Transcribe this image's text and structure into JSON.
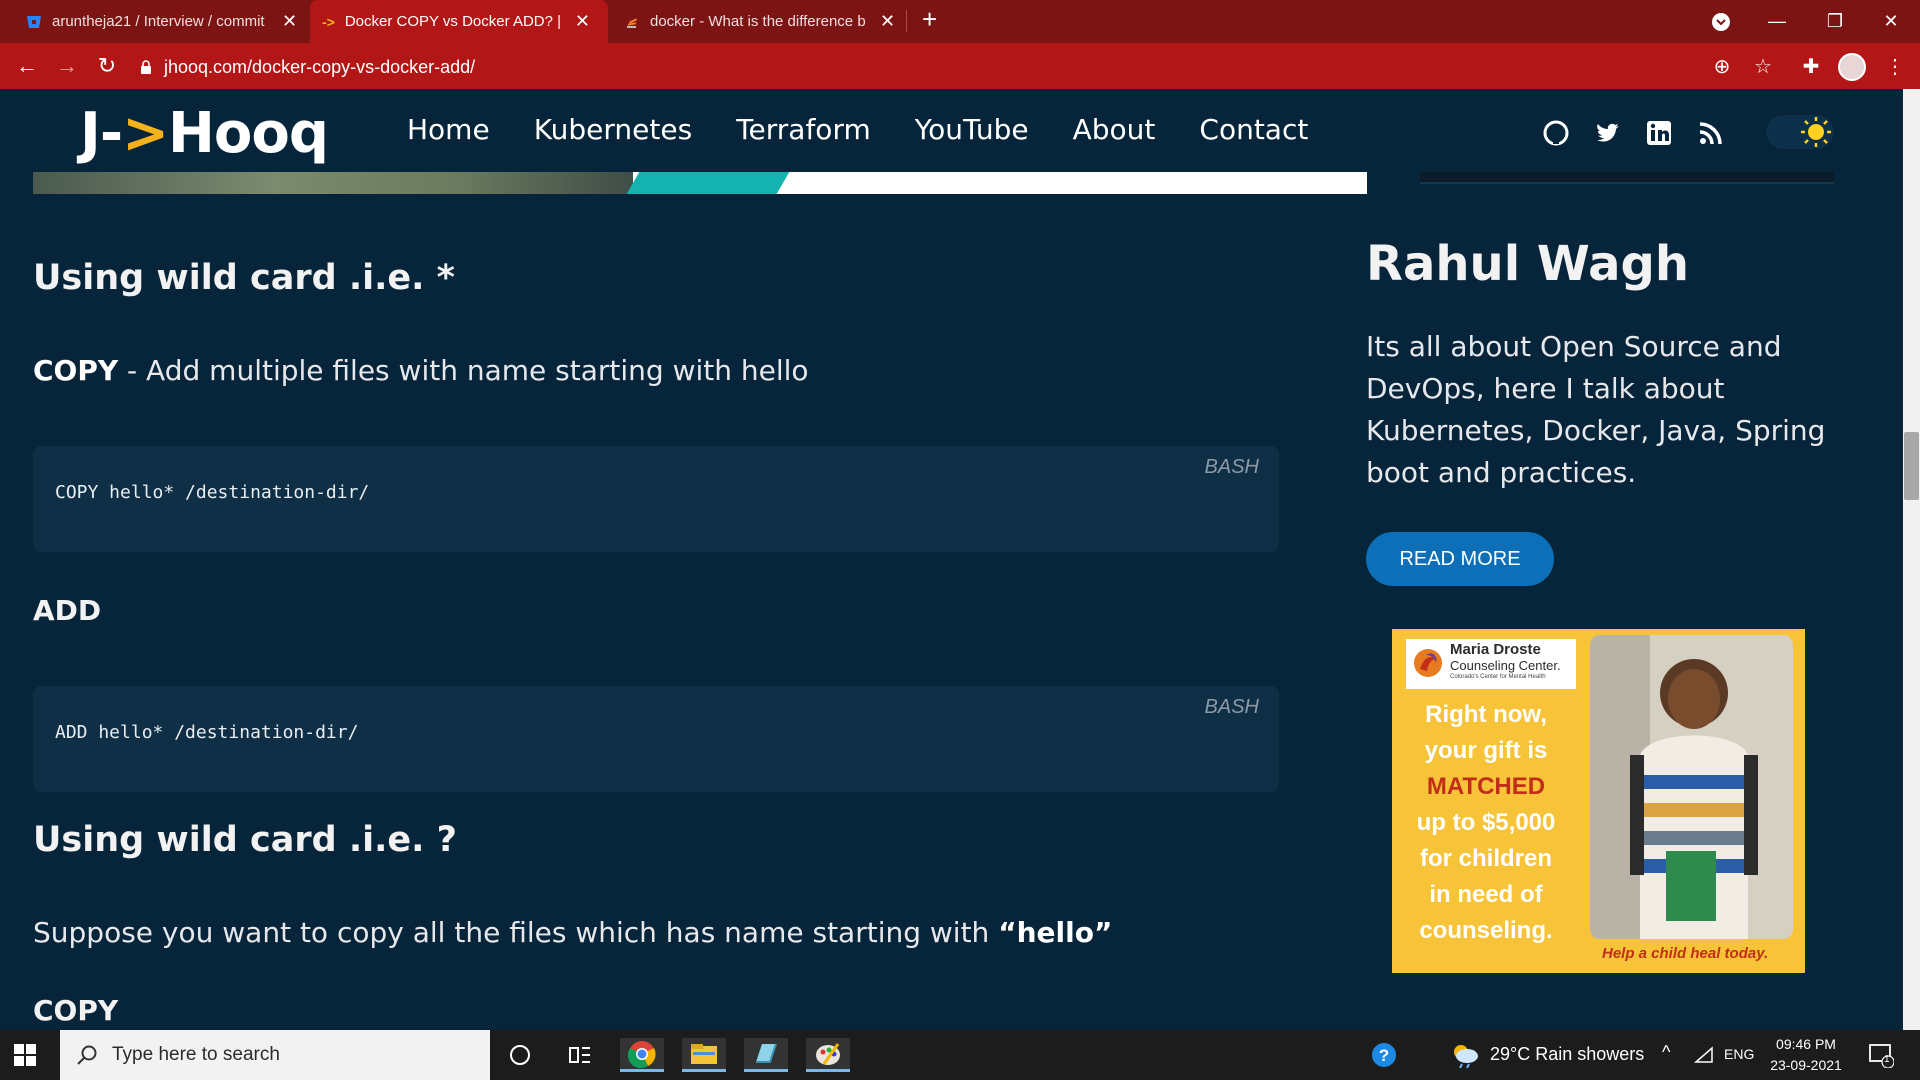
{
  "browser": {
    "tabs": [
      {
        "title": "aruntheja21 / Interview / commit",
        "icon": "bitbucket-icon",
        "active": false
      },
      {
        "title": "Docker COPY vs Docker ADD? | Jh",
        "icon": "jhooq-arrow-icon",
        "active": true
      },
      {
        "title": "docker - What is the difference b",
        "icon": "stackoverflow-icon",
        "active": false
      }
    ],
    "url": "jhooq.com/docker-copy-vs-docker-add/"
  },
  "site": {
    "logo_prefix": "J-",
    "logo_arrow": ">",
    "logo_suffix": "Hooq",
    "menu": [
      "Home",
      "Kubernetes",
      "Terraform",
      "YouTube",
      "About",
      "Contact"
    ],
    "social": [
      "github-icon",
      "twitter-icon",
      "linkedin-icon",
      "rss-icon"
    ]
  },
  "article": {
    "heading1": "Using wild card .i.e. *",
    "copy_label": "COPY",
    "copy_desc": " - Add multiple files with name starting with hello",
    "code1": {
      "code": "COPY hello* /destination-dir/",
      "lang": "BASH"
    },
    "add_heading": "ADD",
    "code2": {
      "code": "ADD hello* /destination-dir/",
      "lang": "BASH"
    },
    "heading2": "Using wild card .i.e. ?",
    "para_prefix": "Suppose you want to copy all the files which has name starting with ",
    "para_bold": "“hello”",
    "copy_heading2": "COPY"
  },
  "sidebar": {
    "author": "Rahul Wagh",
    "bio": "Its all about Open Source and DevOps, here I talk about Kubernetes, Docker, Java, Spring boot and practices.",
    "read_more": "READ MORE",
    "ad": {
      "org_name": "Maria Droste",
      "org_sub": "Counseling Center.",
      "org_tag": "Colorado's Center for Mental Health",
      "line1": "Right now,",
      "line2": "your gift is",
      "line3": "MATCHED",
      "line4": "up to $5,000",
      "line5": "for children",
      "line6": "in need of",
      "line7": "counseling.",
      "footer": "Help a child heal today."
    }
  },
  "taskbar": {
    "search_placeholder": "Type here to search",
    "weather": "29°C  Rain showers",
    "lang": "ENG",
    "time": "09:46 PM",
    "date": "23-09-2021",
    "notif_count": "1"
  }
}
